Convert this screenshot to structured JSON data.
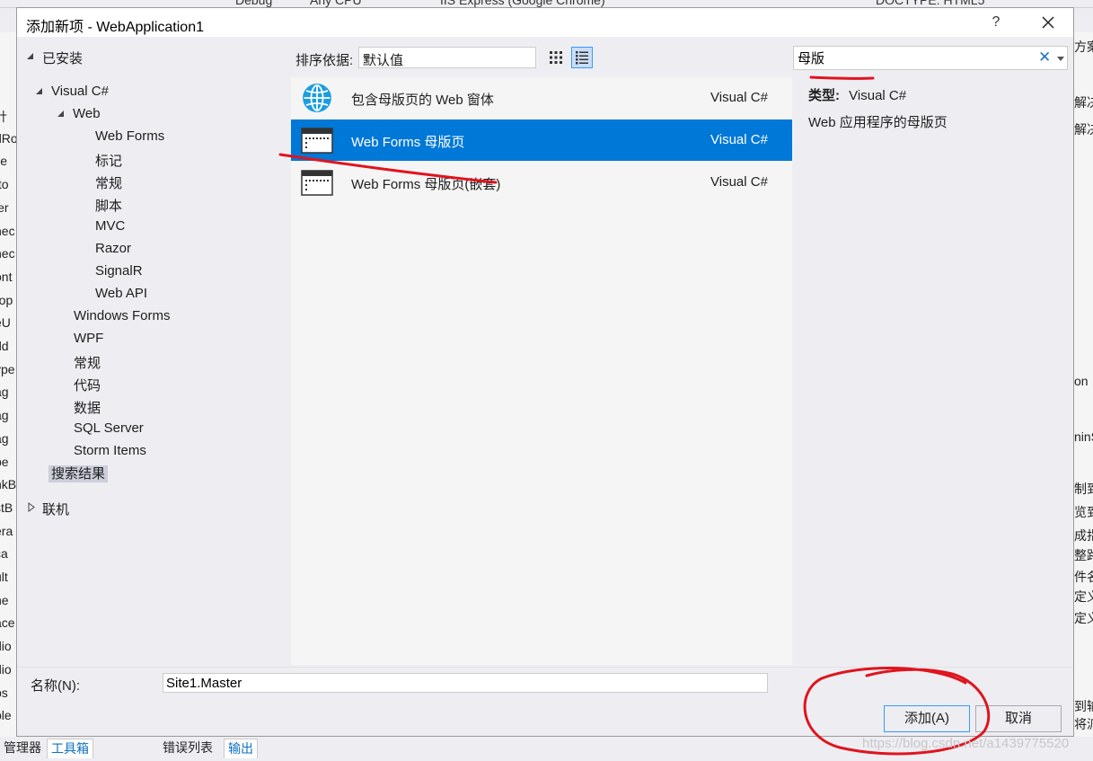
{
  "background": {
    "toolbar_fragments": [
      "Debug",
      "Any CPU",
      "IIS Express (Google Chrome)",
      "DOCTYPE: HTML5"
    ],
    "left_fragments": [
      "针",
      "dRo",
      "lle",
      "tto",
      "ler",
      "nec",
      "hec",
      "ont",
      "rop",
      "eU",
      "dd",
      "ype",
      "ag",
      "ag",
      "ag",
      "be",
      "nkB",
      "stB",
      "era",
      "ca",
      "ult",
      "ne",
      "ace",
      "dio",
      "dio",
      "bs",
      "ble"
    ],
    "right_fragments": [
      "方案",
      "解决",
      "解决",
      "on",
      "ninS",
      "制到",
      "览到",
      "成指",
      "整路",
      "件名",
      "定义",
      "定义",
      "到输",
      "将派"
    ],
    "bottom_tabs": [
      {
        "label": "管理器",
        "active": false
      },
      {
        "label": "工具箱",
        "active": true
      },
      {
        "label": "错误列表",
        "active": false
      },
      {
        "label": "输出",
        "active": true
      }
    ]
  },
  "dialog": {
    "title": "添加新项 - WebApplication1",
    "help": "?"
  },
  "tree": {
    "installed": "已安装",
    "visual_csharp": "Visual C#",
    "web": "Web",
    "web_children": [
      "Web Forms",
      "标记",
      "常规",
      "脚本",
      "MVC",
      "Razor",
      "SignalR",
      "Web API"
    ],
    "csharp_children": [
      "Windows Forms",
      "WPF",
      "常规",
      "代码",
      "数据",
      "SQL Server",
      "Storm Items"
    ],
    "search_results": "搜索结果",
    "online": "联机"
  },
  "toolbar": {
    "sort_label": "排序依据:",
    "sort_value": "默认值"
  },
  "search": {
    "value": "母版",
    "clear_icon": "✕"
  },
  "templates": [
    {
      "name": "包含母版页的 Web 窗体",
      "lang": "Visual C#",
      "icon": "globe-icon",
      "selected": false
    },
    {
      "name": "Web Forms 母版页",
      "lang": "Visual C#",
      "icon": "master-page-icon",
      "selected": true
    },
    {
      "name": "Web Forms 母版页(嵌套)",
      "lang": "Visual C#",
      "icon": "nested-master-page-icon",
      "selected": false
    }
  ],
  "details": {
    "type_label": "类型:",
    "type_value": "Visual C#",
    "description": "Web 应用程序的母版页"
  },
  "name_field": {
    "label": "名称(N):",
    "value": "Site1.Master"
  },
  "buttons": {
    "add": "添加(A)",
    "cancel": "取消"
  },
  "watermark": "https://blog.csdn.net/a1439775520",
  "colors": {
    "accent": "#0078d7",
    "annotation": "#e0141e"
  }
}
